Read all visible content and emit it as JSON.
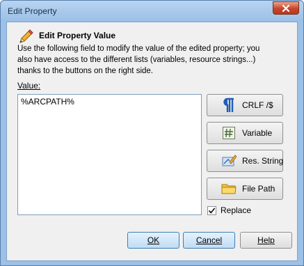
{
  "window": {
    "title": "Edit Property"
  },
  "header": {
    "title": "Edit Property Value",
    "icon": "pencil-icon",
    "description": "Use the following field to modify the value of the edited property; you also have access to the different lists (variables, resource strings...) thanks to the buttons on the right side."
  },
  "value": {
    "label": "Value:",
    "text": "%ARCPATH%"
  },
  "side_buttons": [
    {
      "label": "CRLF /$",
      "icon": "pilcrow-icon"
    },
    {
      "label": "Variable",
      "icon": "hash-icon"
    },
    {
      "label": "Res. String",
      "icon": "resource-string-icon"
    },
    {
      "label": "File Path",
      "icon": "folder-icon"
    }
  ],
  "replace": {
    "label": "Replace",
    "checked": true
  },
  "buttons": {
    "ok": "OK",
    "cancel": "Cancel",
    "help": "Help"
  },
  "colors": {
    "titlebar": "#9bbfe6",
    "close": "#c8442a",
    "default_button": "#bfdcf5"
  }
}
